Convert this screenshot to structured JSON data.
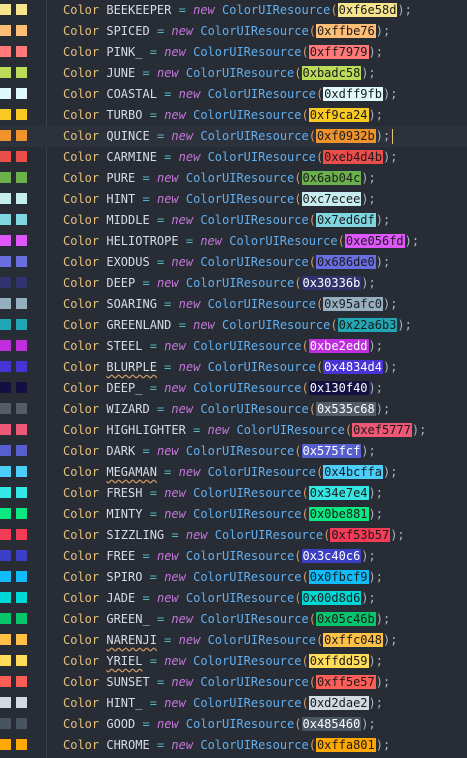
{
  "editor": {
    "keyword": "Color",
    "assign": "=",
    "new_kw": "new",
    "class_name": "ColorUIResource",
    "open_paren": "(",
    "close": ");"
  },
  "rows": [
    {
      "name": "BEEKEEPER",
      "hex": "0xf6e58d",
      "color": "#f6e58d",
      "swatch": "#f6e58d"
    },
    {
      "name": "SPICED",
      "hex": "0xffbe76",
      "color": "#ffbe76",
      "swatch": "#ffbe76"
    },
    {
      "name": "PINK_",
      "hex": "0xff7979",
      "color": "#ff7979",
      "swatch": "#ff7979"
    },
    {
      "name": "JUNE",
      "hex": "0xbadc58",
      "color": "#badc58",
      "swatch": "#badc58"
    },
    {
      "name": "COASTAL",
      "hex": "0xdff9fb",
      "color": "#dff9fb",
      "swatch": "#dff9fb"
    },
    {
      "name": "TURBO",
      "hex": "0xf9ca24",
      "color": "#f9ca24",
      "swatch": "#f9ca24"
    },
    {
      "name": "QUINCE",
      "hex": "0xf0932b",
      "color": "#f0932b",
      "swatch": "#f0932b",
      "current": true
    },
    {
      "name": "CARMINE",
      "hex": "0xeb4d4b",
      "color": "#eb4d4b",
      "swatch": "#eb4d4b"
    },
    {
      "name": "PURE",
      "hex": "0x6ab04c",
      "color": "#6ab04c",
      "swatch": "#6ab04c"
    },
    {
      "name": "HINT",
      "hex": "0xc7ecee",
      "color": "#c7ecee",
      "swatch": "#c7ecee"
    },
    {
      "name": "MIDDLE",
      "hex": "0x7ed6df",
      "color": "#7ed6df",
      "swatch": "#7ed6df"
    },
    {
      "name": "HELIOTROPE",
      "hex": "0xe056fd",
      "color": "#e056fd",
      "swatch": "#e056fd"
    },
    {
      "name": "EXODUS",
      "hex": "0x686de0",
      "color": "#686de0",
      "swatch": "#686de0"
    },
    {
      "name": "DEEP",
      "hex": "0x30336b",
      "color": "#30336b",
      "swatch": "#30336b",
      "light": true
    },
    {
      "name": "SOARING",
      "hex": "0x95afc0",
      "color": "#95afc0",
      "swatch": "#95afc0"
    },
    {
      "name": "GREENLAND",
      "hex": "0x22a6b3",
      "color": "#22a6b3",
      "swatch": "#22a6b3"
    },
    {
      "name": "STEEL",
      "hex": "0xbe2edd",
      "color": "#be2edd",
      "swatch": "#be2edd",
      "light": true
    },
    {
      "name": "BLURPLE",
      "hex": "0x4834d4",
      "color": "#4834d4",
      "swatch": "#4834d4",
      "light": true,
      "squiggle": true
    },
    {
      "name": "DEEP_",
      "hex": "0x130f40",
      "color": "#130f40",
      "swatch": "#130f40",
      "light": true
    },
    {
      "name": "WIZARD",
      "hex": "0x535c68",
      "color": "#535c68",
      "swatch": "#535c68",
      "light": true
    },
    {
      "name": "HIGHLIGHTER",
      "hex": "0xef5777",
      "color": "#ef5777",
      "swatch": "#ef5777"
    },
    {
      "name": "DARK",
      "hex": "0x575fcf",
      "color": "#575fcf",
      "swatch": "#575fcf",
      "light": true
    },
    {
      "name": "MEGAMAN",
      "hex": "0x4bcffa",
      "color": "#4bcffa",
      "swatch": "#4bcffa",
      "squiggle": true
    },
    {
      "name": "FRESH",
      "hex": "0x34e7e4",
      "color": "#34e7e4",
      "swatch": "#34e7e4"
    },
    {
      "name": "MINTY",
      "hex": "0x0be881",
      "color": "#0be881",
      "swatch": "#0be881"
    },
    {
      "name": "SIZZLING",
      "hex": "0xf53b57",
      "color": "#f53b57",
      "swatch": "#f53b57"
    },
    {
      "name": "FREE",
      "hex": "0x3c40c6",
      "color": "#3c40c6",
      "swatch": "#3c40c6",
      "light": true
    },
    {
      "name": "SPIRO",
      "hex": "0x0fbcf9",
      "color": "#0fbcf9",
      "swatch": "#0fbcf9"
    },
    {
      "name": "JADE",
      "hex": "0x00d8d6",
      "color": "#00d8d6",
      "swatch": "#00d8d6"
    },
    {
      "name": "GREEN_",
      "hex": "0x05c46b",
      "color": "#05c46b",
      "swatch": "#05c46b"
    },
    {
      "name": "NARENJI",
      "hex": "0xffc048",
      "color": "#ffc048",
      "swatch": "#ffc048",
      "squiggle": true
    },
    {
      "name": "YRIEL",
      "hex": "0xffdd59",
      "color": "#ffdd59",
      "swatch": "#ffdd59",
      "squiggle": true
    },
    {
      "name": "SUNSET",
      "hex": "0xff5e57",
      "color": "#ff5e57",
      "swatch": "#ff5e57"
    },
    {
      "name": "HINT_",
      "hex": "0xd2dae2",
      "color": "#d2dae2",
      "swatch": "#d2dae2"
    },
    {
      "name": "GOOD",
      "hex": "0x485460",
      "color": "#485460",
      "swatch": "#485460",
      "light": true
    },
    {
      "name": "CHROME",
      "hex": "0xffa801",
      "color": "#ffa801",
      "swatch": "#ffa801"
    }
  ]
}
